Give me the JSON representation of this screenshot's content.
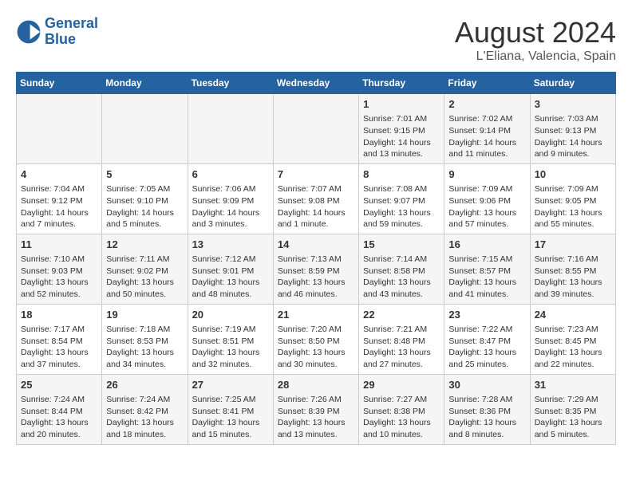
{
  "logo": {
    "line1": "General",
    "line2": "Blue"
  },
  "title": "August 2024",
  "location": "L'Eliana, Valencia, Spain",
  "weekdays": [
    "Sunday",
    "Monday",
    "Tuesday",
    "Wednesday",
    "Thursday",
    "Friday",
    "Saturday"
  ],
  "weeks": [
    [
      {
        "day": "",
        "info": ""
      },
      {
        "day": "",
        "info": ""
      },
      {
        "day": "",
        "info": ""
      },
      {
        "day": "",
        "info": ""
      },
      {
        "day": "1",
        "info": "Sunrise: 7:01 AM\nSunset: 9:15 PM\nDaylight: 14 hours\nand 13 minutes."
      },
      {
        "day": "2",
        "info": "Sunrise: 7:02 AM\nSunset: 9:14 PM\nDaylight: 14 hours\nand 11 minutes."
      },
      {
        "day": "3",
        "info": "Sunrise: 7:03 AM\nSunset: 9:13 PM\nDaylight: 14 hours\nand 9 minutes."
      }
    ],
    [
      {
        "day": "4",
        "info": "Sunrise: 7:04 AM\nSunset: 9:12 PM\nDaylight: 14 hours\nand 7 minutes."
      },
      {
        "day": "5",
        "info": "Sunrise: 7:05 AM\nSunset: 9:10 PM\nDaylight: 14 hours\nand 5 minutes."
      },
      {
        "day": "6",
        "info": "Sunrise: 7:06 AM\nSunset: 9:09 PM\nDaylight: 14 hours\nand 3 minutes."
      },
      {
        "day": "7",
        "info": "Sunrise: 7:07 AM\nSunset: 9:08 PM\nDaylight: 14 hours\nand 1 minute."
      },
      {
        "day": "8",
        "info": "Sunrise: 7:08 AM\nSunset: 9:07 PM\nDaylight: 13 hours\nand 59 minutes."
      },
      {
        "day": "9",
        "info": "Sunrise: 7:09 AM\nSunset: 9:06 PM\nDaylight: 13 hours\nand 57 minutes."
      },
      {
        "day": "10",
        "info": "Sunrise: 7:09 AM\nSunset: 9:05 PM\nDaylight: 13 hours\nand 55 minutes."
      }
    ],
    [
      {
        "day": "11",
        "info": "Sunrise: 7:10 AM\nSunset: 9:03 PM\nDaylight: 13 hours\nand 52 minutes."
      },
      {
        "day": "12",
        "info": "Sunrise: 7:11 AM\nSunset: 9:02 PM\nDaylight: 13 hours\nand 50 minutes."
      },
      {
        "day": "13",
        "info": "Sunrise: 7:12 AM\nSunset: 9:01 PM\nDaylight: 13 hours\nand 48 minutes."
      },
      {
        "day": "14",
        "info": "Sunrise: 7:13 AM\nSunset: 8:59 PM\nDaylight: 13 hours\nand 46 minutes."
      },
      {
        "day": "15",
        "info": "Sunrise: 7:14 AM\nSunset: 8:58 PM\nDaylight: 13 hours\nand 43 minutes."
      },
      {
        "day": "16",
        "info": "Sunrise: 7:15 AM\nSunset: 8:57 PM\nDaylight: 13 hours\nand 41 minutes."
      },
      {
        "day": "17",
        "info": "Sunrise: 7:16 AM\nSunset: 8:55 PM\nDaylight: 13 hours\nand 39 minutes."
      }
    ],
    [
      {
        "day": "18",
        "info": "Sunrise: 7:17 AM\nSunset: 8:54 PM\nDaylight: 13 hours\nand 37 minutes."
      },
      {
        "day": "19",
        "info": "Sunrise: 7:18 AM\nSunset: 8:53 PM\nDaylight: 13 hours\nand 34 minutes."
      },
      {
        "day": "20",
        "info": "Sunrise: 7:19 AM\nSunset: 8:51 PM\nDaylight: 13 hours\nand 32 minutes."
      },
      {
        "day": "21",
        "info": "Sunrise: 7:20 AM\nSunset: 8:50 PM\nDaylight: 13 hours\nand 30 minutes."
      },
      {
        "day": "22",
        "info": "Sunrise: 7:21 AM\nSunset: 8:48 PM\nDaylight: 13 hours\nand 27 minutes."
      },
      {
        "day": "23",
        "info": "Sunrise: 7:22 AM\nSunset: 8:47 PM\nDaylight: 13 hours\nand 25 minutes."
      },
      {
        "day": "24",
        "info": "Sunrise: 7:23 AM\nSunset: 8:45 PM\nDaylight: 13 hours\nand 22 minutes."
      }
    ],
    [
      {
        "day": "25",
        "info": "Sunrise: 7:24 AM\nSunset: 8:44 PM\nDaylight: 13 hours\nand 20 minutes."
      },
      {
        "day": "26",
        "info": "Sunrise: 7:24 AM\nSunset: 8:42 PM\nDaylight: 13 hours\nand 18 minutes."
      },
      {
        "day": "27",
        "info": "Sunrise: 7:25 AM\nSunset: 8:41 PM\nDaylight: 13 hours\nand 15 minutes."
      },
      {
        "day": "28",
        "info": "Sunrise: 7:26 AM\nSunset: 8:39 PM\nDaylight: 13 hours\nand 13 minutes."
      },
      {
        "day": "29",
        "info": "Sunrise: 7:27 AM\nSunset: 8:38 PM\nDaylight: 13 hours\nand 10 minutes."
      },
      {
        "day": "30",
        "info": "Sunrise: 7:28 AM\nSunset: 8:36 PM\nDaylight: 13 hours\nand 8 minutes."
      },
      {
        "day": "31",
        "info": "Sunrise: 7:29 AM\nSunset: 8:35 PM\nDaylight: 13 hours\nand 5 minutes."
      }
    ]
  ]
}
